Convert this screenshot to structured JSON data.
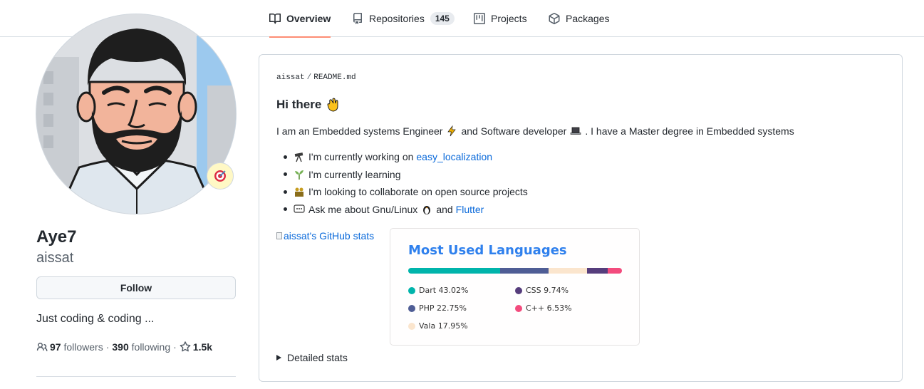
{
  "nav": {
    "tabs": [
      {
        "label": "Overview",
        "icon": "book-icon"
      },
      {
        "label": "Repositories",
        "icon": "repo-icon",
        "count": "145"
      },
      {
        "label": "Projects",
        "icon": "project-icon"
      },
      {
        "label": "Packages",
        "icon": "package-icon"
      }
    ],
    "active_tab": "Overview",
    "active_color": "#fd8c73"
  },
  "profile": {
    "name": "Aye7",
    "login": "aissat",
    "follow_label": "Follow",
    "bio": "Just coding & coding ...",
    "followers_count": "97",
    "followers_label": "followers",
    "separator": "·",
    "following_count": "390",
    "following_label": "following",
    "stars_count": "1.5k",
    "status_icon": "dart-target-icon"
  },
  "readme": {
    "path_owner": "aissat",
    "path_sep": "/",
    "path_file": "README.md",
    "heading": "Hi there",
    "heading_icon": "waving-hand-icon",
    "intro_a": "I am an Embedded systems Engineer",
    "intro_b": "and Software developer",
    "intro_c": ". I have a Master degree in Embedded systems",
    "bullets": [
      {
        "icon": "telescope-icon",
        "text": "I'm currently working on",
        "link": "easy_localization"
      },
      {
        "icon": "seedling-icon",
        "text": "I'm currently learning"
      },
      {
        "icon": "people-icon",
        "text": "I'm looking to collaborate on open source projects"
      },
      {
        "icon": "speech-bubble-icon",
        "text": "Ask me about Gnu/Linux",
        "mid_icon": "penguin-icon",
        "text2": "and",
        "link": "Flutter"
      }
    ],
    "stats_alt": "aissat's GitHub stats",
    "details_label": "Detailed stats",
    "link_color": "#0969da"
  },
  "languages": {
    "title": "Most Used Languages",
    "title_color": "#2f80ed",
    "items": [
      {
        "name": "Dart",
        "percent": "43.02%",
        "value": 43.02,
        "color": "#00B4AB"
      },
      {
        "name": "PHP",
        "percent": "22.75%",
        "value": 22.75,
        "color": "#4F5D95"
      },
      {
        "name": "Vala",
        "percent": "17.95%",
        "value": 17.95,
        "color": "#fbe5cd"
      },
      {
        "name": "CSS",
        "percent": "9.74%",
        "value": 9.74,
        "color": "#563d7c"
      },
      {
        "name": "C++",
        "percent": "6.53%",
        "value": 6.53,
        "color": "#f34b7d"
      }
    ]
  }
}
